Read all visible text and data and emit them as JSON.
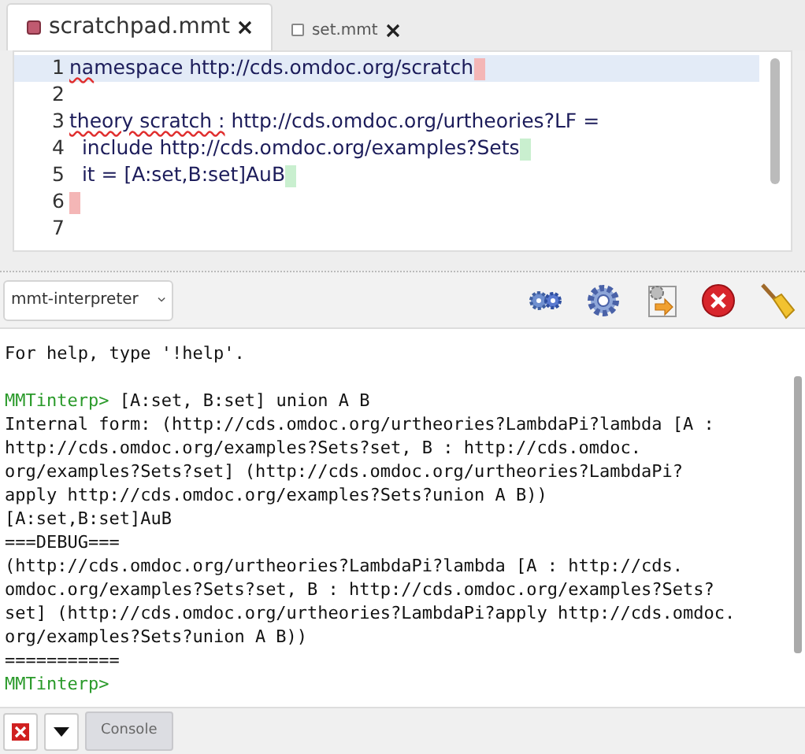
{
  "tabs": [
    {
      "label": "scratchpad.mmt",
      "selected": true
    },
    {
      "label": "set.mmt",
      "selected": false
    }
  ],
  "editor": {
    "lines": [
      {
        "number": "1",
        "highlighted": true,
        "segments": [
          {
            "text": "na",
            "squiggle": true
          },
          {
            "text": "mespace http://cds.omdoc.org/scratch",
            "squiggle": false
          }
        ],
        "color": "#f4b6b6"
      },
      {
        "number": "2",
        "highlighted": false
      },
      {
        "number": "3",
        "highlighted": false,
        "segments": [
          {
            "text": "theory scratch :",
            "squiggle": true
          },
          {
            "text": " http://cds.omdoc.org/urtheories?LF =",
            "squiggle": false
          }
        ]
      },
      {
        "number": "4",
        "highlighted": false,
        "segments": [
          {
            "text": "  include http://cds.omdoc.org/examples?Sets",
            "squiggle": false
          }
        ],
        "color": "#c9efcf"
      },
      {
        "number": "5",
        "highlighted": false,
        "segments": [
          {
            "text": "  it = [A:set,B:set]AuB",
            "squiggle": false
          }
        ],
        "color": "#c9efcf"
      },
      {
        "number": "6",
        "highlighted": false,
        "color": "#f4b6b6"
      },
      {
        "number": "7",
        "highlighted": false
      }
    ]
  },
  "interpreter_select": {
    "value": "mmt-interpreter"
  },
  "console": {
    "lines": [
      {
        "kind": "output",
        "text": "For help, type '!help'."
      },
      {
        "kind": "blank"
      },
      {
        "kind": "prompt",
        "prompt": "MMTinterp>",
        "text": " [A:set, B:set] union A B"
      },
      {
        "kind": "output",
        "text": "Internal form: (http://cds.omdoc.org/urtheories?LambdaPi?lambda [A :"
      },
      {
        "kind": "output",
        "text": "http://cds.omdoc.org/examples?Sets?set, B : http://cds.omdoc."
      },
      {
        "kind": "output",
        "text": "org/examples?Sets?set] (http://cds.omdoc.org/urtheories?LambdaPi?"
      },
      {
        "kind": "output",
        "text": "apply http://cds.omdoc.org/examples?Sets?union A B))"
      },
      {
        "kind": "output",
        "text": "[A:set,B:set]AuB"
      },
      {
        "kind": "output",
        "text": "===DEBUG==="
      },
      {
        "kind": "output",
        "text": "(http://cds.omdoc.org/urtheories?LambdaPi?lambda [A : http://cds."
      },
      {
        "kind": "output",
        "text": "omdoc.org/examples?Sets?set, B : http://cds.omdoc.org/examples?Sets?"
      },
      {
        "kind": "output",
        "text": "set] (http://cds.omdoc.org/urtheories?LambdaPi?apply http://cds.omdoc."
      },
      {
        "kind": "output",
        "text": "org/examples?Sets?union A B))"
      },
      {
        "kind": "output",
        "text": "==========="
      },
      {
        "kind": "prompt",
        "prompt": "MMTinterp>"
      }
    ]
  },
  "bottom_bar": {
    "console_button": "Console"
  }
}
